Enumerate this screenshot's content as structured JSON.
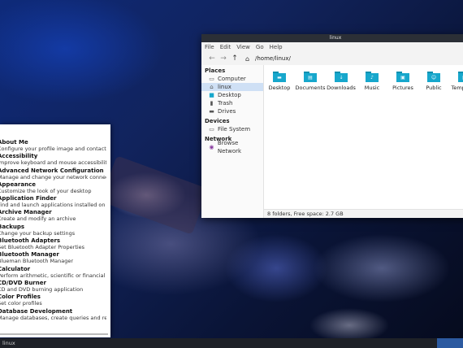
{
  "file_manager": {
    "title": "linux",
    "menu": [
      "File",
      "Edit",
      "View",
      "Go",
      "Help"
    ],
    "toolbar": {
      "back_icon": "←",
      "forward_icon": "→",
      "up_icon": "↑",
      "home_icon": "⌂"
    },
    "path": "/home/linux/",
    "sidebar": {
      "places_header": "Places",
      "places": [
        {
          "label": "Computer",
          "icon": "computer-icon"
        },
        {
          "label": "linux",
          "icon": "home-icon",
          "selected": true
        },
        {
          "label": "Desktop",
          "icon": "desktop-icon"
        },
        {
          "label": "Trash",
          "icon": "trash-icon"
        },
        {
          "label": "Drives",
          "icon": "drives-icon"
        }
      ],
      "devices_header": "Devices",
      "devices": [
        {
          "label": "File System",
          "icon": "disk-icon"
        }
      ],
      "network_header": "Network",
      "network": [
        {
          "label": "Browse Network",
          "icon": "network-icon"
        }
      ]
    },
    "folders": [
      "Desktop",
      "Documents",
      "Downloads",
      "Music",
      "Pictures",
      "Public",
      "Templates"
    ],
    "status": "8 folders, Free space: 2.7 GB"
  },
  "settings_panel": {
    "items": [
      {
        "title": "About Me",
        "desc": "Configure your profile image and contact details"
      },
      {
        "title": "Accessibility",
        "desc": "Improve keyboard and mouse accessibility"
      },
      {
        "title": "Advanced Network Configuration",
        "desc": "Manage and change your network connection settings"
      },
      {
        "title": "Appearance",
        "desc": "Customize the look of your desktop"
      },
      {
        "title": "Application Finder",
        "desc": "Find and launch applications installed on your system"
      },
      {
        "title": "Archive Manager",
        "desc": "Create and modify an archive"
      },
      {
        "title": "Backups",
        "desc": "Change your backup settings"
      },
      {
        "title": "Bluetooth Adapters",
        "desc": "Set Bluetooth Adapter Properties"
      },
      {
        "title": "Bluetooth Manager",
        "desc": "Blueman Bluetooth Manager"
      },
      {
        "title": "Calculator",
        "desc": "Perform arithmetic, scientific or financial calculations"
      },
      {
        "title": "CD/DVD Burner",
        "desc": "CD and DVD burning application"
      },
      {
        "title": "Color Profiles",
        "desc": "Set color profiles"
      },
      {
        "title": "Database Development",
        "desc": "Manage databases, create queries and reports to track data"
      }
    ]
  },
  "taskbar": {
    "task_label": "linux"
  }
}
